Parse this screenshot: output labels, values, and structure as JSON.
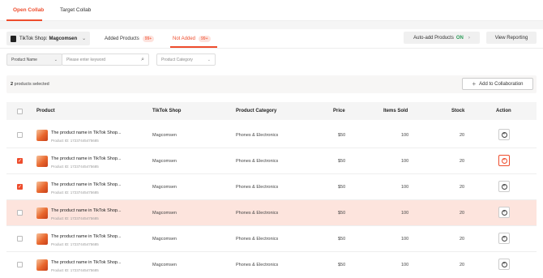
{
  "tabs": [
    {
      "label": "Open Collab"
    },
    {
      "label": "Target Collab"
    }
  ],
  "shop": {
    "prefix": "TikTok Shop:",
    "name": "Magcomsen"
  },
  "subtabs": [
    {
      "label": "Added Products",
      "badge": "99+"
    },
    {
      "label": "Not Added",
      "badge": "99+"
    }
  ],
  "auto_add": {
    "label": "Auto-add Products",
    "state": "ON"
  },
  "view_reporting": "View Reporting",
  "filters": {
    "name_select": "Product Name",
    "search_placeholder": "Please enter keyword",
    "category_placeholder": "Product Category"
  },
  "selection": {
    "count": "2",
    "text": "products selected"
  },
  "add_collab": "Add to Collaboration",
  "columns": {
    "product": "Product",
    "shop": "TikTok Shop",
    "category": "Product Category",
    "price": "Price",
    "sold": "Items Sold",
    "stock": "Stock",
    "action": "Action"
  },
  "rows": [
    {
      "name": "The product name in TikTok Shop...",
      "id": "Product ID: 17237445475685",
      "shop": "Magcomsen",
      "category": "Phones & Electronics",
      "price": "$50",
      "sold": "100",
      "stock": "20",
      "checked": false
    },
    {
      "name": "The product name in TikTok Shop...",
      "id": "Product ID: 17237445475685",
      "shop": "Magcomsen",
      "category": "Phones & Electronics",
      "price": "$50",
      "sold": "100",
      "stock": "20",
      "checked": true
    },
    {
      "name": "The product name in TikTok Shop...",
      "id": "Product ID: 17237445475685",
      "shop": "Magcomsen",
      "category": "Phones & Electronics",
      "price": "$50",
      "sold": "100",
      "stock": "20",
      "checked": true
    },
    {
      "name": "The product name in TikTok Shop...",
      "id": "Product ID: 17237445475685",
      "shop": "Magcomsen",
      "category": "Phones & Electronics",
      "price": "$50",
      "sold": "100",
      "stock": "20",
      "checked": false
    },
    {
      "name": "The product name in TikTok Shop...",
      "id": "Product ID: 17237445475685",
      "shop": "Magcomsen",
      "category": "Phones & Electronics",
      "price": "$50",
      "sold": "100",
      "stock": "20",
      "checked": false
    },
    {
      "name": "The product name in TikTok Shop...",
      "id": "Product ID: 17237445475685",
      "shop": "Magcomsen",
      "category": "Phones & Electronics",
      "price": "$50",
      "sold": "100",
      "stock": "20",
      "checked": false
    }
  ],
  "colors": {
    "accent": "#ee4d2d",
    "highlight": "#fde4dd",
    "on": "#2e9d5a"
  }
}
